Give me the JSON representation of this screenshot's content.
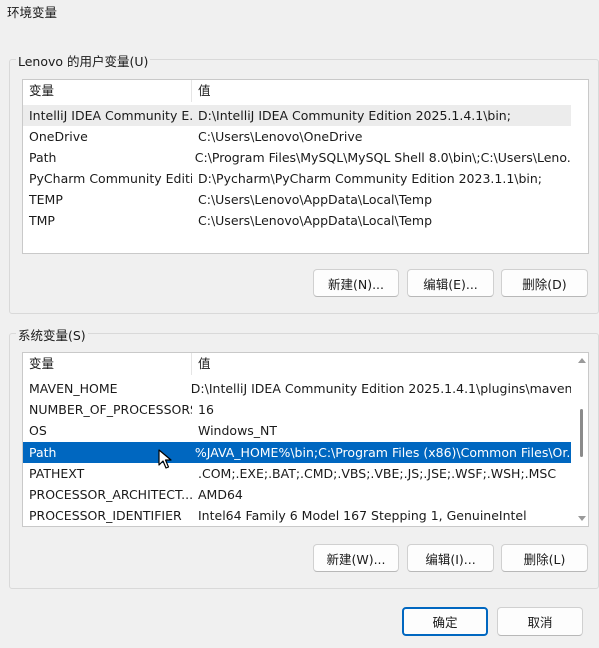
{
  "window": {
    "title": "环境变量"
  },
  "user_vars": {
    "group_label": "Lenovo 的用户变量(U)",
    "columns": [
      "变量",
      "值"
    ],
    "rows": [
      {
        "name": "IntelliJ IDEA Community E...",
        "value": "D:\\IntelliJ IDEA Community Edition 2025.1.4.1\\bin;"
      },
      {
        "name": "OneDrive",
        "value": "C:\\Users\\Lenovo\\OneDrive"
      },
      {
        "name": "Path",
        "value": "C:\\Program Files\\MySQL\\MySQL Shell 8.0\\bin\\;C:\\Users\\Leno..."
      },
      {
        "name": "PyCharm Community Editi...",
        "value": "D:\\Pycharm\\PyCharm Community Edition 2023.1.1\\bin;"
      },
      {
        "name": "TEMP",
        "value": "C:\\Users\\Lenovo\\AppData\\Local\\Temp"
      },
      {
        "name": "TMP",
        "value": "C:\\Users\\Lenovo\\AppData\\Local\\Temp"
      }
    ],
    "buttons": {
      "new": "新建(N)...",
      "edit": "编辑(E)...",
      "delete": "删除(D)"
    }
  },
  "system_vars": {
    "group_label": "系统变量(S)",
    "columns": [
      "变量",
      "值"
    ],
    "rows": [
      {
        "name": "MAVEN_HOME",
        "value": "D:\\IntelliJ IDEA Community Edition 2025.1.4.1\\plugins\\maven\\..."
      },
      {
        "name": "NUMBER_OF_PROCESSORS",
        "value": "16"
      },
      {
        "name": "OS",
        "value": "Windows_NT"
      },
      {
        "name": "Path",
        "value": "%JAVA_HOME%\\bin;C:\\Program Files (x86)\\Common Files\\Or..."
      },
      {
        "name": "PATHEXT",
        "value": ".COM;.EXE;.BAT;.CMD;.VBS;.VBE;.JS;.JSE;.WSF;.WSH;.MSC"
      },
      {
        "name": "PROCESSOR_ARCHITECT...",
        "value": "AMD64"
      },
      {
        "name": "PROCESSOR_IDENTIFIER",
        "value": "Intel64 Family 6 Model 167 Stepping 1, GenuineIntel"
      }
    ],
    "selected_row": "Path",
    "buttons": {
      "new": "新建(W)...",
      "edit": "编辑(I)...",
      "delete": "删除(L)"
    }
  },
  "footer": {
    "ok": "确定",
    "cancel": "取消"
  },
  "colors": {
    "selection": "#0067c0",
    "default_button_border": "#0067c0"
  },
  "icons": {
    "pointer": "mouse-pointer-icon"
  }
}
